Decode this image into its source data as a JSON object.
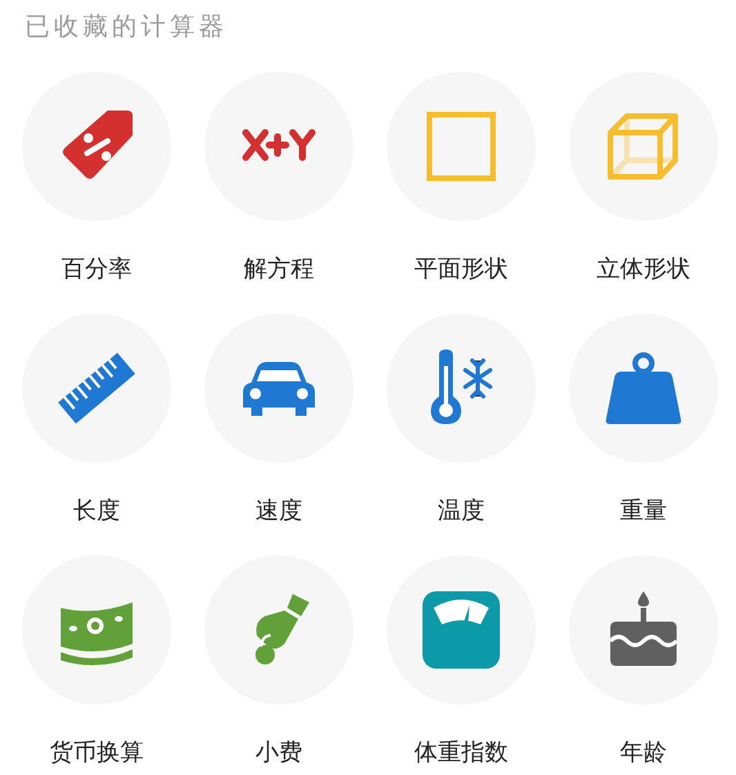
{
  "section_title": "已收藏的计算器",
  "calculators": [
    {
      "label": "百分率",
      "kind": "tag"
    },
    {
      "label": "解方程",
      "kind": "equation"
    },
    {
      "label": "平面形状",
      "kind": "square"
    },
    {
      "label": "立体形状",
      "kind": "cube"
    },
    {
      "label": "长度",
      "kind": "ruler"
    },
    {
      "label": "速度",
      "kind": "car"
    },
    {
      "label": "温度",
      "kind": "thermometer"
    },
    {
      "label": "重量",
      "kind": "weight"
    },
    {
      "label": "货币换算",
      "kind": "money"
    },
    {
      "label": "小费",
      "kind": "tip"
    },
    {
      "label": "体重指数",
      "kind": "scale"
    },
    {
      "label": "年龄",
      "kind": "cake"
    }
  ]
}
